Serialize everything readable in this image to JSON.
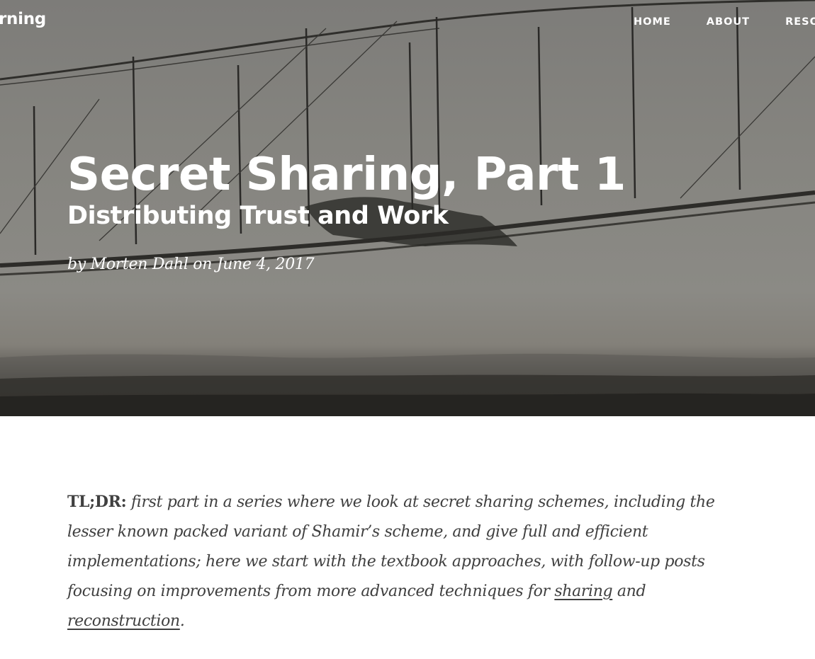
{
  "navbar": {
    "brand": "rning",
    "links": [
      "HOME",
      "ABOUT",
      "RESO"
    ]
  },
  "header": {
    "title": "Secret Sharing, Part 1",
    "subtitle": "Distributing Trust and Work",
    "meta": "by Morten Dahl on June 4, 2017"
  },
  "article": {
    "tldr_label": "TL;DR:",
    "text_before": " first part in a series where we look at secret sharing schemes, including the lesser known packed variant of Shamir’s scheme, and give full and efficient implementations; here we start with the textbook approaches, with follow-up posts focusing on improvements from more advanced techniques for ",
    "link_sharing": "sharing",
    "text_middle": " and ",
    "link_reconstruction": "reconstruction",
    "text_after": "."
  },
  "colors": {
    "text": "#404040",
    "header_text": "#ffffff",
    "hero_tone": "#85847f"
  }
}
